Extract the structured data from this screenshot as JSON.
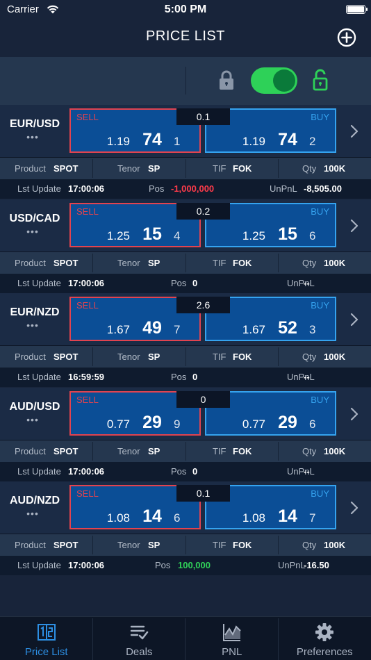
{
  "status_bar": {
    "carrier": "Carrier",
    "time": "5:00 PM"
  },
  "header": {
    "title": "PRICE LIST"
  },
  "lock_toggle": {
    "on": true
  },
  "labels": {
    "sell": "SELL",
    "buy": "BUY",
    "product": "Product",
    "tenor": "Tenor",
    "tif": "TIF",
    "qty": "Qty",
    "last_update": "Lst Update",
    "pos": "Pos",
    "unpnl": "UnPnL",
    "more": "•••"
  },
  "rows": [
    {
      "pair": "EUR/USD",
      "spread": "0.1",
      "sell": {
        "big": "1.19",
        "pips": "74",
        "frac": "1"
      },
      "buy": {
        "big": "1.19",
        "pips": "74",
        "frac": "2"
      },
      "product": "SPOT",
      "tenor": "SP",
      "tif": "FOK",
      "qty": "100K",
      "updated": "17:00:06",
      "pos": "-1,000,000",
      "unpnl": "-8,505.00"
    },
    {
      "pair": "USD/CAD",
      "spread": "0.2",
      "sell": {
        "big": "1.25",
        "pips": "15",
        "frac": "4"
      },
      "buy": {
        "big": "1.25",
        "pips": "15",
        "frac": "6"
      },
      "product": "SPOT",
      "tenor": "SP",
      "tif": "FOK",
      "qty": "100K",
      "updated": "17:00:06",
      "pos": "0",
      "unpnl": "--"
    },
    {
      "pair": "EUR/NZD",
      "spread": "2.6",
      "sell": {
        "big": "1.67",
        "pips": "49",
        "frac": "7"
      },
      "buy": {
        "big": "1.67",
        "pips": "52",
        "frac": "3"
      },
      "product": "SPOT",
      "tenor": "SP",
      "tif": "FOK",
      "qty": "100K",
      "updated": "16:59:59",
      "pos": "0",
      "unpnl": "--"
    },
    {
      "pair": "AUD/USD",
      "spread": "0",
      "sell": {
        "big": "0.77",
        "pips": "29",
        "frac": "9"
      },
      "buy": {
        "big": "0.77",
        "pips": "29",
        "frac": "6"
      },
      "product": "SPOT",
      "tenor": "SP",
      "tif": "FOK",
      "qty": "100K",
      "updated": "17:00:06",
      "pos": "0",
      "unpnl": "--"
    },
    {
      "pair": "AUD/NZD",
      "spread": "0.1",
      "sell": {
        "big": "1.08",
        "pips": "14",
        "frac": "6"
      },
      "buy": {
        "big": "1.08",
        "pips": "14",
        "frac": "7"
      },
      "product": "SPOT",
      "tenor": "SP",
      "tif": "FOK",
      "qty": "100K",
      "updated": "17:00:06",
      "pos": "100,000",
      "unpnl": "-16.50"
    }
  ],
  "tabs": [
    {
      "label": "Price List",
      "icon": "price-list-icon",
      "active": true
    },
    {
      "label": "Deals",
      "icon": "deals-icon",
      "active": false
    },
    {
      "label": "PNL",
      "icon": "pnl-chart-icon",
      "active": false
    },
    {
      "label": "Preferences",
      "icon": "gear-icon",
      "active": false
    }
  ],
  "colors": {
    "background": "#18243a",
    "sell": "#e2434f",
    "buy": "#35a3ef",
    "quote_fill": "#0b4e96",
    "toggle_on": "#2ed158",
    "positive": "#30d158",
    "negative": "#ff3b4a",
    "active_tab": "#2d8fe3"
  }
}
